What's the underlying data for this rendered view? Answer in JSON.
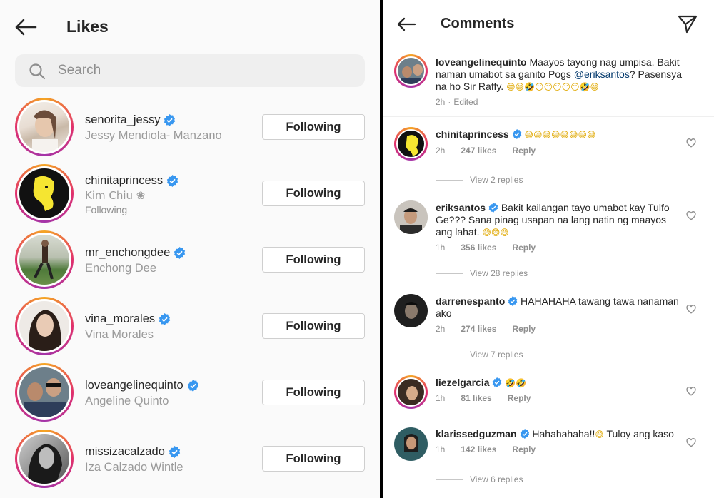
{
  "likes": {
    "title": "Likes",
    "search_placeholder": "Search",
    "users": [
      {
        "username": "senorita_jessy",
        "fullname": "Jessy Mendiola- Manzano",
        "extra": "",
        "button": "Following"
      },
      {
        "username": "chinitaprincess",
        "fullname": "Kim Chiu ❀",
        "extra": "Following",
        "button": "Following"
      },
      {
        "username": "mr_enchongdee",
        "fullname": "Enchong Dee",
        "extra": "",
        "button": "Following"
      },
      {
        "username": "vina_morales",
        "fullname": "Vina Morales",
        "extra": "",
        "button": "Following"
      },
      {
        "username": "loveangelinequinto",
        "fullname": "Angeline Quinto",
        "extra": "",
        "button": "Following"
      },
      {
        "username": "missizacalzado",
        "fullname": "Iza Calzado Wintle",
        "extra": "",
        "button": "Following"
      }
    ]
  },
  "comments": {
    "title": "Comments",
    "caption": {
      "username": "loveangelinequinto",
      "text_before": " Maayos tayong nag umpisa. Bakit naman umabot sa ganito Pogs ",
      "mention": "@eriksantos",
      "text_after": "? Pasensya na ho Sir Raffy. ",
      "emojis": "😅😅🤣😶😶😶😶😶🤣😅",
      "time": "2h",
      "edited": "Edited"
    },
    "items": [
      {
        "username": "chinitaprincess",
        "text": "",
        "emojis": "😅😅😅😅😅😅😅😅",
        "time": "2h",
        "likes": "247 likes",
        "reply": "Reply",
        "view_replies": "View 2 replies"
      },
      {
        "username": "eriksantos",
        "text": "Bakit kailangan tayo umabot kay Tulfo Ge??? Sana pinag usapan na lang natin ng maayos ang lahat. ",
        "emojis": "😅😅😅",
        "time": "1h",
        "likes": "356 likes",
        "reply": "Reply",
        "view_replies": "View 28 replies"
      },
      {
        "username": "darrenespanto",
        "text": "HAHAHAHA tawang tawa nanaman ako",
        "emojis": "",
        "time": "2h",
        "likes": "274 likes",
        "reply": "Reply",
        "view_replies": "View 7 replies"
      },
      {
        "username": "liezelgarcia",
        "text": "",
        "emojis": "🤣🤣",
        "time": "1h",
        "likes": "81 likes",
        "reply": "Reply",
        "view_replies": ""
      },
      {
        "username": "klarissedguzman",
        "text": "Hahahahaha!!",
        "emojis": "😅",
        "text2": " Tuloy ang kaso",
        "time": "1h",
        "likes": "142 likes",
        "reply": "Reply",
        "view_replies": "View 6 replies"
      }
    ]
  },
  "colors": {
    "verified": "#3897f0",
    "ring_start": "#f5a623",
    "ring_mid": "#e1306c",
    "muted": "#8e8e8e"
  },
  "icons": [
    "back-arrow-icon",
    "search-icon",
    "verified-badge-icon",
    "send-icon",
    "heart-outline-icon"
  ]
}
